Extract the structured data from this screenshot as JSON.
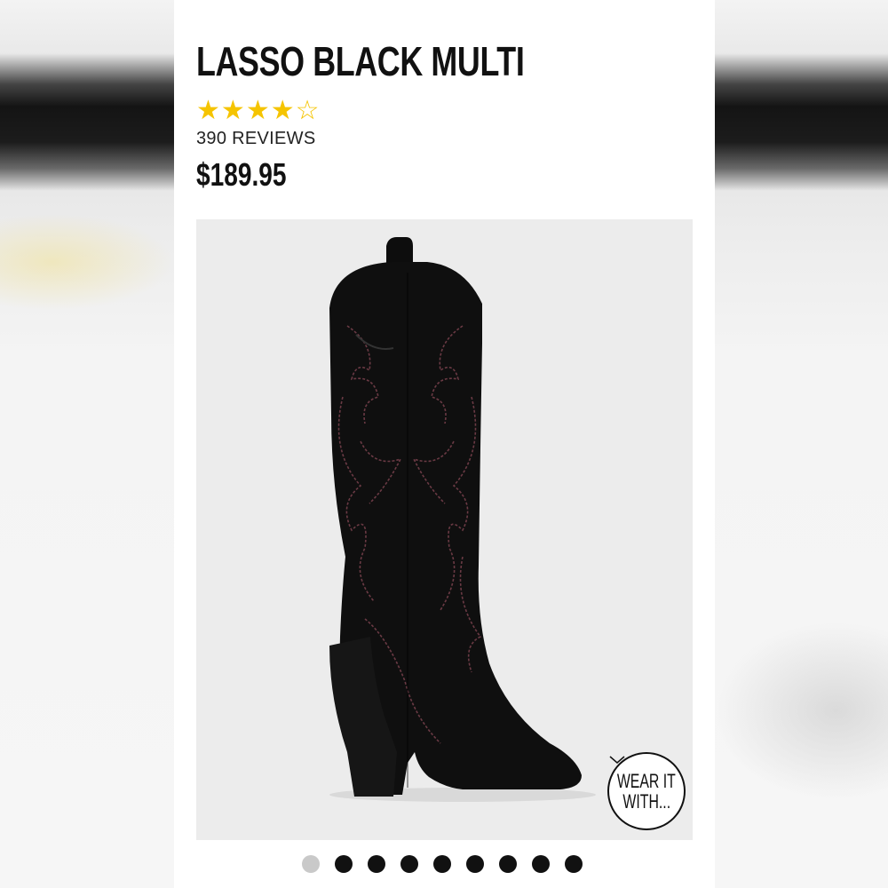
{
  "product": {
    "title": "LASSO BLACK MULTI",
    "rating": {
      "value": 4,
      "max": 5,
      "star_color": "#f5c400"
    },
    "reviews_label": "390 REVIEWS",
    "price": "$189.95"
  },
  "gallery": {
    "image_name": "black-western-knee-high-boot",
    "wear_it_with": {
      "line1": "WEAR IT",
      "line2": "WITH..."
    },
    "dot_count": 9,
    "active_dot": 0
  },
  "colors": {
    "text": "#111111",
    "photo_bg": "#ececec",
    "dot_inactive": "#111111",
    "dot_active": "#c9c9c9"
  }
}
